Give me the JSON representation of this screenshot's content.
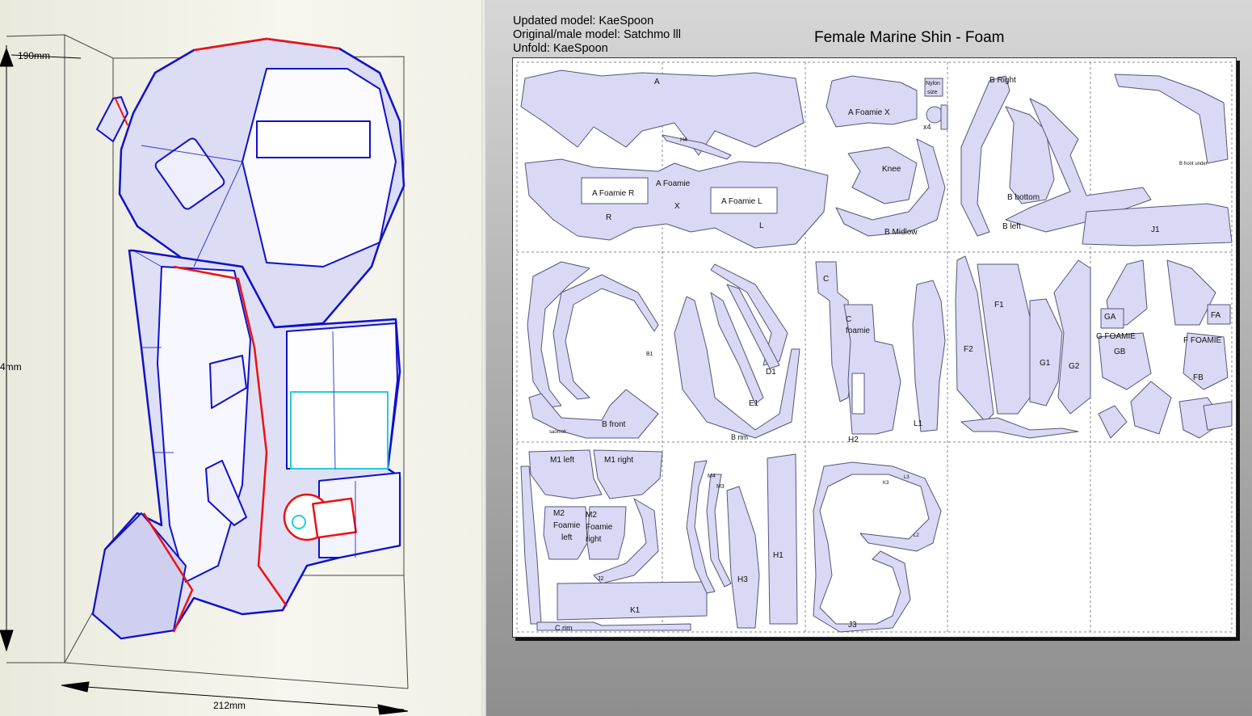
{
  "viewport_3d": {
    "dimensions": {
      "depth": "190mm",
      "width": "212mm",
      "height_partial": "4mm"
    }
  },
  "sheet": {
    "credits": [
      "Updated model: KaeSpoon",
      "Original/male model: Satchmo lll",
      "Unfold: KaeSpoon"
    ],
    "title": "Female Marine Shin - Foam",
    "part_labels": {
      "a": "A",
      "h4": "H4",
      "a_foamie": "A Foamie",
      "a_foamie_r": "A Foamie R",
      "a_foamie_l": "A Foamie L",
      "r": "R",
      "x": "X",
      "l": "L",
      "a_foamie_x": "A Foamie X",
      "nylon": "Nylon",
      "size": "size",
      "x4": "x4",
      "knee": "Knee",
      "b_midlow": "B Midlow",
      "b_right": "B Right",
      "b_bottom": "B bottom",
      "b_left": "B left",
      "b_front_under": "B front under",
      "j1": "J1",
      "b1": "B1",
      "b_front": "B front",
      "saomoll": "saomoll",
      "d1": "D1",
      "e1": "E1",
      "b_rim": "B rim",
      "c": "C",
      "c_foamie_1": "C",
      "c_foamie_2": "foamie",
      "l1": "L1",
      "h2": "H2",
      "f1": "F1",
      "f2": "F2",
      "g1": "G1",
      "g2": "G2",
      "ga": "GA",
      "g_foamie": "G FOAMIE",
      "gb": "GB",
      "fa": "FA",
      "f_foamie": "F FOAMIE",
      "fb": "FB",
      "m1_left": "M1 left",
      "m1_right": "M1 right",
      "m2_a": "M2",
      "m2_b": "Foamie",
      "m2_c": "left",
      "m2r_a": "M2",
      "m2r_b": "Foamie",
      "m2r_c": "right",
      "j2": "J2",
      "k1": "K1",
      "c_rim": "C rim",
      "m4": "M4",
      "m3": "M3",
      "h3": "H3",
      "h1": "H1",
      "l3": "L3",
      "k3": "K3",
      "l2": "L2",
      "j3": "J3"
    }
  },
  "colors": {
    "part_fill": "#d9d9f5",
    "part_stroke": "#555577",
    "model_blue": "#1010cc",
    "model_cyan": "#22ccdd",
    "model_red": "#ee1111"
  }
}
